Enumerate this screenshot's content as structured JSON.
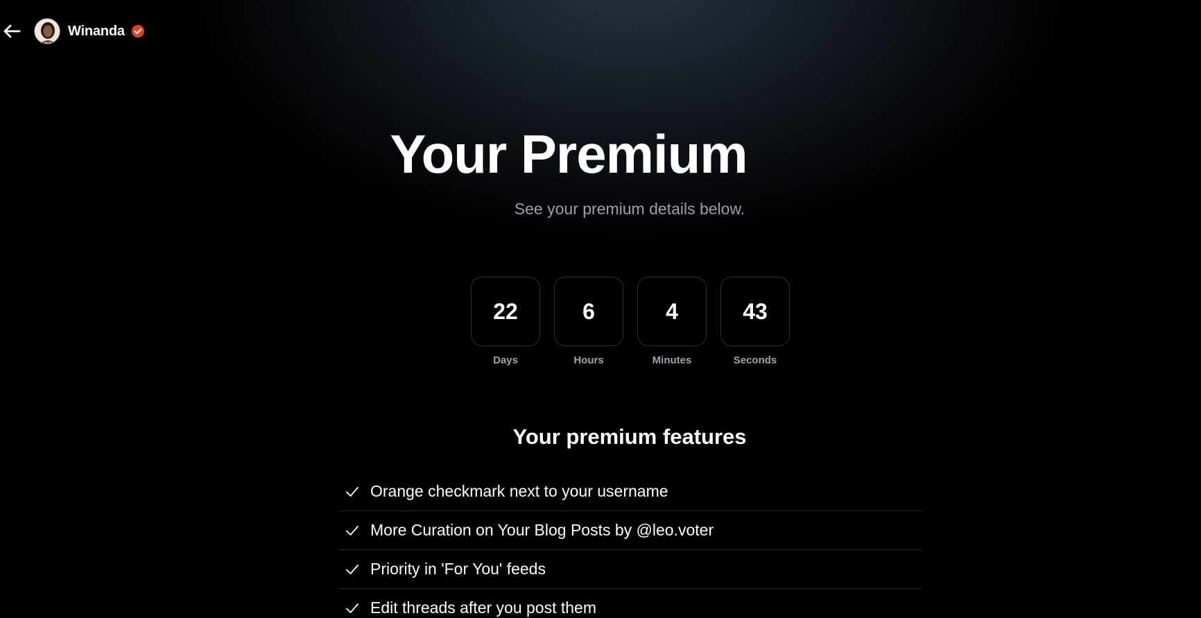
{
  "header": {
    "username": "Winanda",
    "back_icon": "arrow-left-icon",
    "avatar_icon": "user-avatar",
    "verified_icon": "verified-badge-icon",
    "verified_color": "#e8401c"
  },
  "hero": {
    "title": "Your Premium",
    "subtitle": "See your premium details below."
  },
  "countdown": {
    "units": [
      {
        "value": "22",
        "label": "Days"
      },
      {
        "value": "6",
        "label": "Hours"
      },
      {
        "value": "4",
        "label": "Minutes"
      },
      {
        "value": "43",
        "label": "Seconds"
      }
    ]
  },
  "features": {
    "title": "Your premium features",
    "check_icon": "check-icon",
    "items": [
      "Orange checkmark next to your username",
      "More Curation on Your Blog Posts by @leo.voter",
      "Priority in 'For You' feeds",
      "Edit threads after you post them"
    ]
  },
  "colors": {
    "background": "#000000",
    "text": "#ffffff",
    "muted": "#9aa0a6",
    "accent": "#e8401c"
  }
}
